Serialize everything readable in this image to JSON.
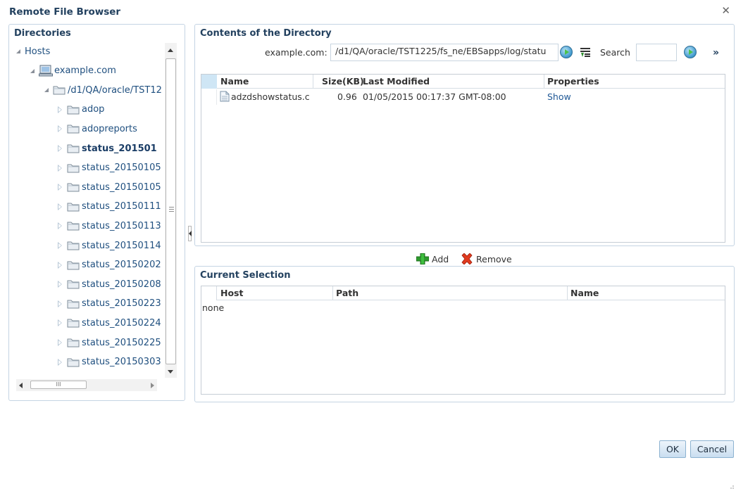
{
  "dialog": {
    "title": "Remote File Browser",
    "close_icon": "close-icon"
  },
  "directories": {
    "header": "Directories",
    "tree": [
      {
        "label": "Hosts",
        "level": 0,
        "expanded": true,
        "icon": ""
      },
      {
        "label": "example.com",
        "level": 1,
        "expanded": true,
        "icon": "host-icon"
      },
      {
        "label": "/d1/QA/oracle/TST12",
        "level": 2,
        "expanded": true,
        "icon": "folder-icon"
      },
      {
        "label": "adop",
        "level": 3,
        "expanded": false,
        "icon": "folder-icon"
      },
      {
        "label": "adopreports",
        "level": 3,
        "expanded": false,
        "icon": "folder-icon"
      },
      {
        "label": "status_201501",
        "level": 3,
        "expanded": false,
        "icon": "folder-icon",
        "selected": true
      },
      {
        "label": "status_20150105",
        "level": 3,
        "expanded": false,
        "icon": "folder-icon"
      },
      {
        "label": "status_20150105",
        "level": 3,
        "expanded": false,
        "icon": "folder-icon"
      },
      {
        "label": "status_20150111",
        "level": 3,
        "expanded": false,
        "icon": "folder-icon"
      },
      {
        "label": "status_20150113",
        "level": 3,
        "expanded": false,
        "icon": "folder-icon"
      },
      {
        "label": "status_20150114",
        "level": 3,
        "expanded": false,
        "icon": "folder-icon"
      },
      {
        "label": "status_20150202",
        "level": 3,
        "expanded": false,
        "icon": "folder-icon"
      },
      {
        "label": "status_20150208",
        "level": 3,
        "expanded": false,
        "icon": "folder-icon"
      },
      {
        "label": "status_20150223",
        "level": 3,
        "expanded": false,
        "icon": "folder-icon"
      },
      {
        "label": "status_20150224",
        "level": 3,
        "expanded": false,
        "icon": "folder-icon"
      },
      {
        "label": "status_20150225",
        "level": 3,
        "expanded": false,
        "icon": "folder-icon"
      },
      {
        "label": "status_20150303",
        "level": 3,
        "expanded": false,
        "icon": "folder-icon"
      }
    ]
  },
  "contents": {
    "header": "Contents of the Directory",
    "host_label": "example.com:",
    "path_value": "/d1/QA/oracle/TST1225/fs_ne/EBSapps/log/statu",
    "search_label": "Search",
    "search_value": "",
    "columns": {
      "name": "Name",
      "size": "Size(KB)",
      "modified": "Last Modified",
      "properties": "Properties"
    },
    "rows": [
      {
        "name": "adzdshowstatus.c",
        "size": "0.96",
        "modified": "01/05/2015 00:17:37 GMT-08:00",
        "properties": "Show"
      }
    ]
  },
  "actions": {
    "add_label": "Add",
    "remove_label": "Remove"
  },
  "selection": {
    "header": "Current Selection",
    "columns": {
      "host": "Host",
      "path": "Path",
      "name": "Name"
    },
    "empty_text": "none"
  },
  "buttons": {
    "ok": "OK",
    "cancel": "Cancel"
  },
  "colors": {
    "header_text": "#23415f",
    "link": "#1f5896",
    "panel_border": "#c4d4e3",
    "selected_header": "#cfe6f5"
  }
}
